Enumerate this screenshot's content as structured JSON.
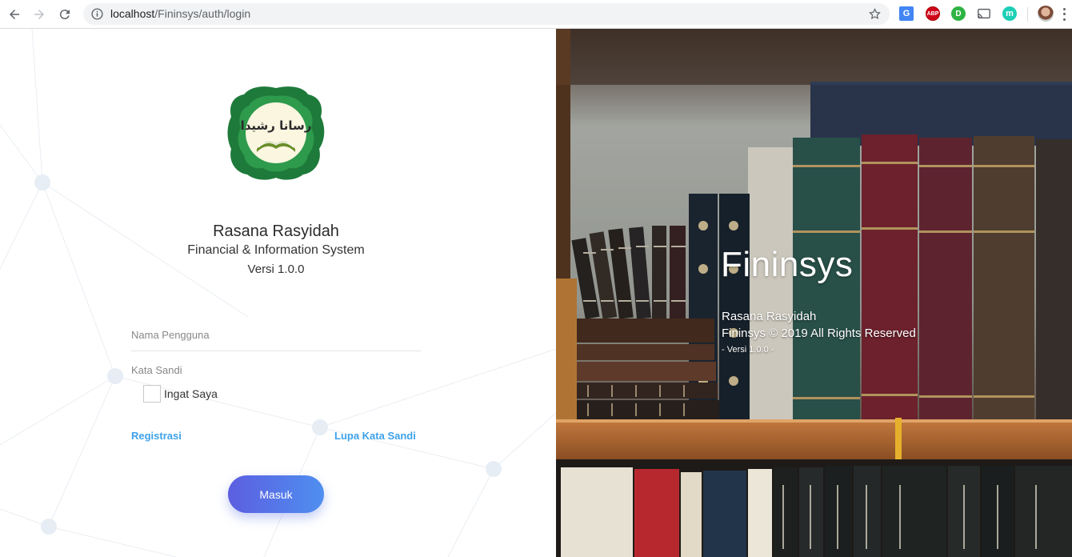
{
  "browser": {
    "url_host": "localhost",
    "url_path": "/Fininsys/auth/login",
    "extensions": {
      "translate": "G",
      "abp": "ABP",
      "green": "D",
      "mint": "m"
    }
  },
  "login": {
    "logo_text": "رسانا رشيدا",
    "org_name": "Rasana Rasyidah",
    "system_name": "Financial & Information System",
    "version": "Versi 1.0.0",
    "username_placeholder": "Nama Pengguna",
    "password_placeholder": "Kata Sandi",
    "remember_label": "Ingat Saya",
    "register_link": "Registrasi",
    "forgot_link": "Lupa Kata Sandi",
    "submit_label": "Masuk"
  },
  "hero": {
    "title": "Fininsys",
    "org": "Rasana Rasyidah",
    "copyright": "Fininsys © 2019 All Rights Reserved",
    "version_note": "- Versi 1.0.0 -"
  },
  "colors": {
    "link": "#3ea2ea",
    "button_start": "#5c5ee0",
    "button_end": "#4f8ff0",
    "logo_green": "#1e7a3a"
  }
}
